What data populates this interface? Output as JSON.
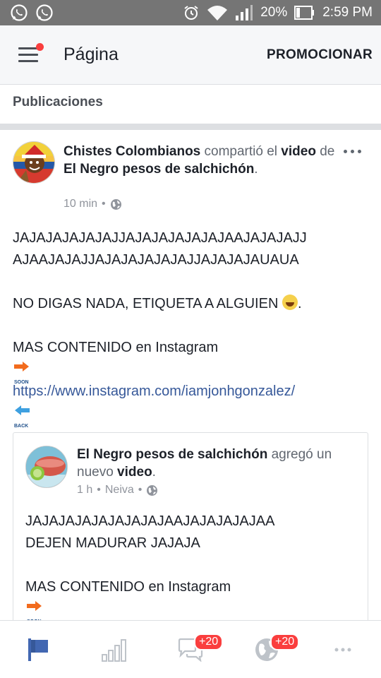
{
  "status_bar": {
    "battery": "20%",
    "time": "2:59 PM"
  },
  "app_bar": {
    "title": "Página",
    "promote_label": "PROMOCIONAR"
  },
  "section": {
    "label": "Publicaciones"
  },
  "post": {
    "author": "Chistes Colombianos",
    "verb": " compartió el ",
    "object": "video",
    "prep": " de ",
    "source": "El Negro pesos de salchichón",
    "end": ".",
    "time": "10 min",
    "text_line1": "JAJAJAJAJAJAJJAJAJAJAJAJAJAAJAJAJAJJ",
    "text_line2": "AJAAJAJAJJAJAJAJAJAJAJJAJAJAJAUAUA",
    "text_line3": "NO DIGAS NADA, ETIQUETA A ALGUIEN",
    "text_line4": "MAS CONTENIDO en Instagram",
    "soon_label": "SOON",
    "link": "https://www.instagram.com/iamjonhgonzalez/",
    "back_label": "BACK",
    "shared": {
      "author": "El Negro pesos de salchichón",
      "verb": " agregó un nuevo ",
      "object": "video",
      "end": ".",
      "time": "1 h",
      "location": "Neiva",
      "text_line1": "JAJAJAJAJAJAJAJAJAAJAJAJAJAJAA",
      "text_line2": "DEJEN MADURAR JAJAJA",
      "text_line3": "MAS CONTENIDO en Instagram",
      "soon_label": "SOON"
    }
  },
  "bottom_nav": {
    "messages_badge": "+20",
    "notifications_badge": "+20"
  },
  "colors": {
    "accent": "#4267b2",
    "badge": "#fa3e3e",
    "status_bar": "#757575"
  }
}
